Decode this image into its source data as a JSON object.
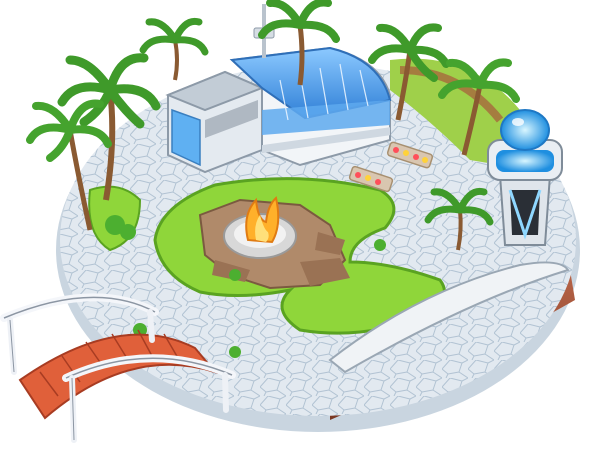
{
  "scene": {
    "palette": {
      "plaza_tile": "#dfe7ee",
      "plaza_grout": "#aebfd0",
      "rim_rock": "#a8533a",
      "rim_rock_dark": "#7e3a26",
      "grass": "#8fd63a",
      "grass_dark": "#5aa321",
      "palm_leaf": "#3f9a2a",
      "palm_trunk": "#8a5a32",
      "glass": "#4da3f0",
      "building_white": "#f2f5f8",
      "bridge_plank": "#e0603a",
      "bridge_rail": "#f4f6fa",
      "tower_glow": "#39b8ff",
      "fire": "#ffb02a",
      "stone": "#b08a6a"
    },
    "icons": [
      "palm-tree-icon",
      "fire-pit-icon",
      "glass-dome-building-icon",
      "observation-tower-icon",
      "bridge-icon",
      "flower-planter-icon"
    ]
  }
}
